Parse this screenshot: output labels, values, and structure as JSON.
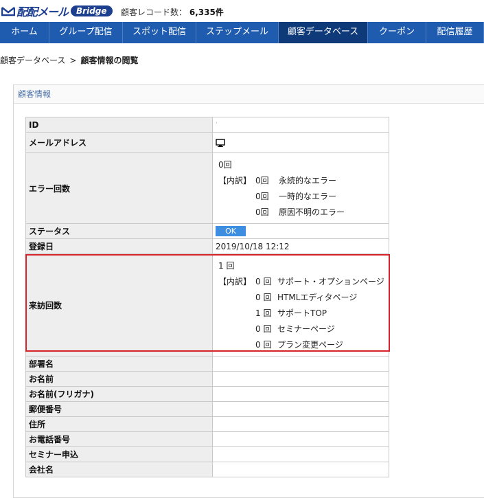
{
  "header": {
    "logo_text": "配配メール",
    "logo_badge": "Bridge",
    "record_label": "顧客レコード数：",
    "record_count": "6,335件"
  },
  "nav": {
    "items": [
      {
        "label": "ホーム"
      },
      {
        "label": "グループ配信"
      },
      {
        "label": "スポット配信"
      },
      {
        "label": "ステップメール"
      },
      {
        "label": "顧客データベース"
      },
      {
        "label": "クーポン"
      },
      {
        "label": "配信履歴"
      }
    ]
  },
  "breadcrumb": {
    "parent": "顧客データベース",
    "separator": ">",
    "current": "顧客情報の閲覧"
  },
  "panel": {
    "title": "顧客情報"
  },
  "rows": {
    "id": {
      "label": "ID",
      "value": "'"
    },
    "email": {
      "label": "メールアドレス",
      "icon": "monitor-icon"
    },
    "errors": {
      "label": "エラー回数",
      "total": "0回",
      "breakdown_label": "【内訳】",
      "items": [
        {
          "count": "0回",
          "name": "永続的なエラー"
        },
        {
          "count": "0回",
          "name": "一時的なエラー"
        },
        {
          "count": "0回",
          "name": "原因不明のエラー"
        }
      ]
    },
    "status": {
      "label": "ステータス",
      "value": "OK"
    },
    "registered": {
      "label": "登録日",
      "value": "2019/10/18 12:12"
    },
    "visits": {
      "label": "来訪回数",
      "total": "1 回",
      "breakdown_label": "【内訳】",
      "items": [
        {
          "count": "0 回",
          "name": "サポート・オプションページ"
        },
        {
          "count": "0 回",
          "name": "HTMLエディタページ"
        },
        {
          "count": "1 回",
          "name": "サポートTOP"
        },
        {
          "count": "0 回",
          "name": "セミナーページ"
        },
        {
          "count": "0 回",
          "name": "プラン変更ページ"
        }
      ]
    },
    "department": {
      "label": "部署名"
    },
    "name": {
      "label": "お名前"
    },
    "name_kana": {
      "label": "お名前(フリガナ)"
    },
    "postal": {
      "label": "郵便番号"
    },
    "address": {
      "label": "住所"
    },
    "phone": {
      "label": "お電話番号"
    },
    "seminar": {
      "label": "セミナー申込"
    },
    "company": {
      "label": "会社名"
    }
  },
  "colors": {
    "nav_bg": "#1f5cb0",
    "nav_active": "#0f3a7a",
    "highlight": "#d8222a",
    "ok_button": "#3d8de0"
  }
}
